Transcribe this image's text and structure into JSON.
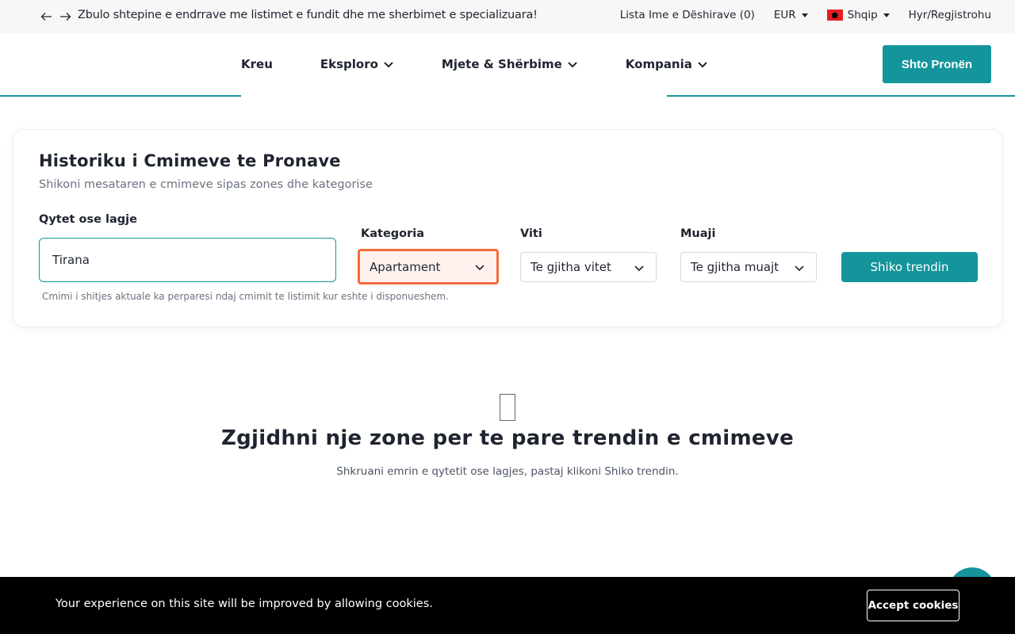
{
  "topbar": {
    "announcement": "Zbulo shtepine e endrrave me listimet e fundit dhe me sherbimet e specializuara!",
    "wishlist": "Lista Ime e Dëshirave (0)",
    "currency": "EUR",
    "language": "Shqip",
    "login": "Hyr/Regjistrohu"
  },
  "nav": {
    "items": [
      {
        "label": "Kreu",
        "has_dropdown": false
      },
      {
        "label": "Eksploro",
        "has_dropdown": true
      },
      {
        "label": "Mjete & Shërbime",
        "has_dropdown": true
      },
      {
        "label": "Kompania",
        "has_dropdown": true
      }
    ],
    "cta_label": "Shto Pronën"
  },
  "search": {
    "title": "Historiku i Cmimeve te Pronave",
    "subtitle": "Shikoni mesataren e cmimeve sipas zones dhe kategorise",
    "city_label": "Qytet ose lagje",
    "city_value": "Tirana",
    "hint": "Cmimi i shitjes aktuale ka perparesi ndaj cmimit te listimit kur eshte i disponueshem.",
    "category_label": "Kategoria",
    "category_value": "Apartament",
    "year_label": "Viti",
    "year_value": "Te gjitha vitet",
    "month_label": "Muaji",
    "month_value": "Te gjitha muajt",
    "button_label": "Shiko trendin"
  },
  "empty_state": {
    "title": "Zgjidhni nje zone per te pare trendin e cmimeve",
    "subtitle": "Shkruani emrin e qytetit ose lagjes, pastaj klikoni Shiko trendin."
  },
  "cookie": {
    "message": "Your experience on this site will be improved by allowing cookies.",
    "accept_label": "Accept cookies"
  },
  "colors": {
    "accent": "#14959b",
    "focus": "#f26b3a",
    "topbar_bg": "#f7f7f7",
    "cookie_bg": "#000000"
  }
}
